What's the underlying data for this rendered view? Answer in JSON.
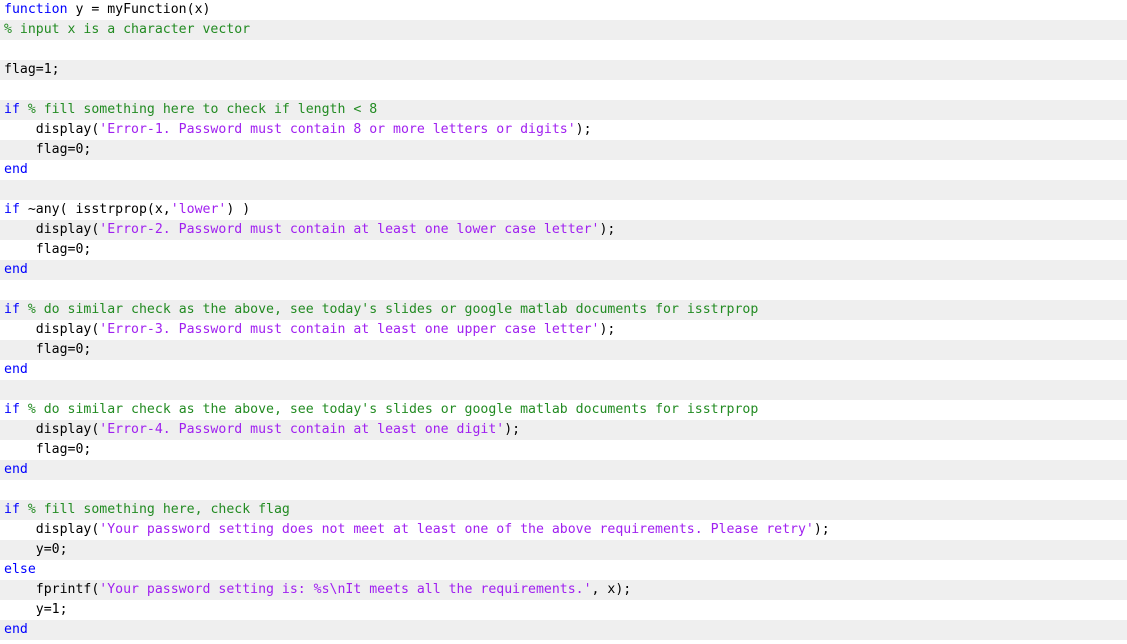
{
  "code_lines": [
    [
      {
        "t": "function",
        "c": "keyword"
      },
      {
        "t": " y = myFunction(x)",
        "c": "plain"
      }
    ],
    [
      {
        "t": "% input x is a character vector",
        "c": "comment"
      }
    ],
    [],
    [
      {
        "t": "flag=1;",
        "c": "plain"
      }
    ],
    [],
    [
      {
        "t": "if",
        "c": "keyword"
      },
      {
        "t": " ",
        "c": "plain"
      },
      {
        "t": "% fill something here to check if length < 8",
        "c": "comment"
      }
    ],
    [
      {
        "t": "    display(",
        "c": "plain"
      },
      {
        "t": "'Error-1. Password must contain 8 or more letters or digits'",
        "c": "string"
      },
      {
        "t": ");",
        "c": "plain"
      }
    ],
    [
      {
        "t": "    flag=0;",
        "c": "plain"
      }
    ],
    [
      {
        "t": "end",
        "c": "keyword"
      }
    ],
    [],
    [
      {
        "t": "if",
        "c": "keyword"
      },
      {
        "t": " ~any( isstrprop(x,",
        "c": "plain"
      },
      {
        "t": "'lower'",
        "c": "string"
      },
      {
        "t": ") )",
        "c": "plain"
      }
    ],
    [
      {
        "t": "    display(",
        "c": "plain"
      },
      {
        "t": "'Error-2. Password must contain at least one lower case letter'",
        "c": "string"
      },
      {
        "t": ");",
        "c": "plain"
      }
    ],
    [
      {
        "t": "    flag=0;",
        "c": "plain"
      }
    ],
    [
      {
        "t": "end",
        "c": "keyword"
      }
    ],
    [],
    [
      {
        "t": "if",
        "c": "keyword"
      },
      {
        "t": " ",
        "c": "plain"
      },
      {
        "t": "% do similar check as the above, see today's slides or google matlab documents for isstrprop",
        "c": "comment"
      }
    ],
    [
      {
        "t": "    display(",
        "c": "plain"
      },
      {
        "t": "'Error-3. Password must contain at least one upper case letter'",
        "c": "string"
      },
      {
        "t": ");",
        "c": "plain"
      }
    ],
    [
      {
        "t": "    flag=0;",
        "c": "plain"
      }
    ],
    [
      {
        "t": "end",
        "c": "keyword"
      }
    ],
    [],
    [
      {
        "t": "if",
        "c": "keyword"
      },
      {
        "t": " ",
        "c": "plain"
      },
      {
        "t": "% do similar check as the above, see today's slides or google matlab documents for isstrprop",
        "c": "comment"
      }
    ],
    [
      {
        "t": "    display(",
        "c": "plain"
      },
      {
        "t": "'Error-4. Password must contain at least one digit'",
        "c": "string"
      },
      {
        "t": ");",
        "c": "plain"
      }
    ],
    [
      {
        "t": "    flag=0;",
        "c": "plain"
      }
    ],
    [
      {
        "t": "end",
        "c": "keyword"
      }
    ],
    [],
    [
      {
        "t": "if",
        "c": "keyword"
      },
      {
        "t": " ",
        "c": "plain"
      },
      {
        "t": "% fill something here, check flag",
        "c": "comment"
      }
    ],
    [
      {
        "t": "    display(",
        "c": "plain"
      },
      {
        "t": "'Your password setting does not meet at least one of the above requirements. Please retry'",
        "c": "string"
      },
      {
        "t": ");",
        "c": "plain"
      }
    ],
    [
      {
        "t": "    y=0;",
        "c": "plain"
      }
    ],
    [
      {
        "t": "else",
        "c": "keyword"
      }
    ],
    [
      {
        "t": "    fprintf(",
        "c": "plain"
      },
      {
        "t": "'Your password setting is: %s\\nIt meets all the requirements.'",
        "c": "string"
      },
      {
        "t": ", x);",
        "c": "plain"
      }
    ],
    [
      {
        "t": "    y=1;",
        "c": "plain"
      }
    ],
    [
      {
        "t": "end",
        "c": "keyword"
      }
    ]
  ],
  "colors": {
    "keyword": "#0000ff",
    "comment": "#228b22",
    "string": "#a020f0",
    "plain": "#000000",
    "row_even": "#ffffff",
    "row_odd": "#efefef"
  }
}
